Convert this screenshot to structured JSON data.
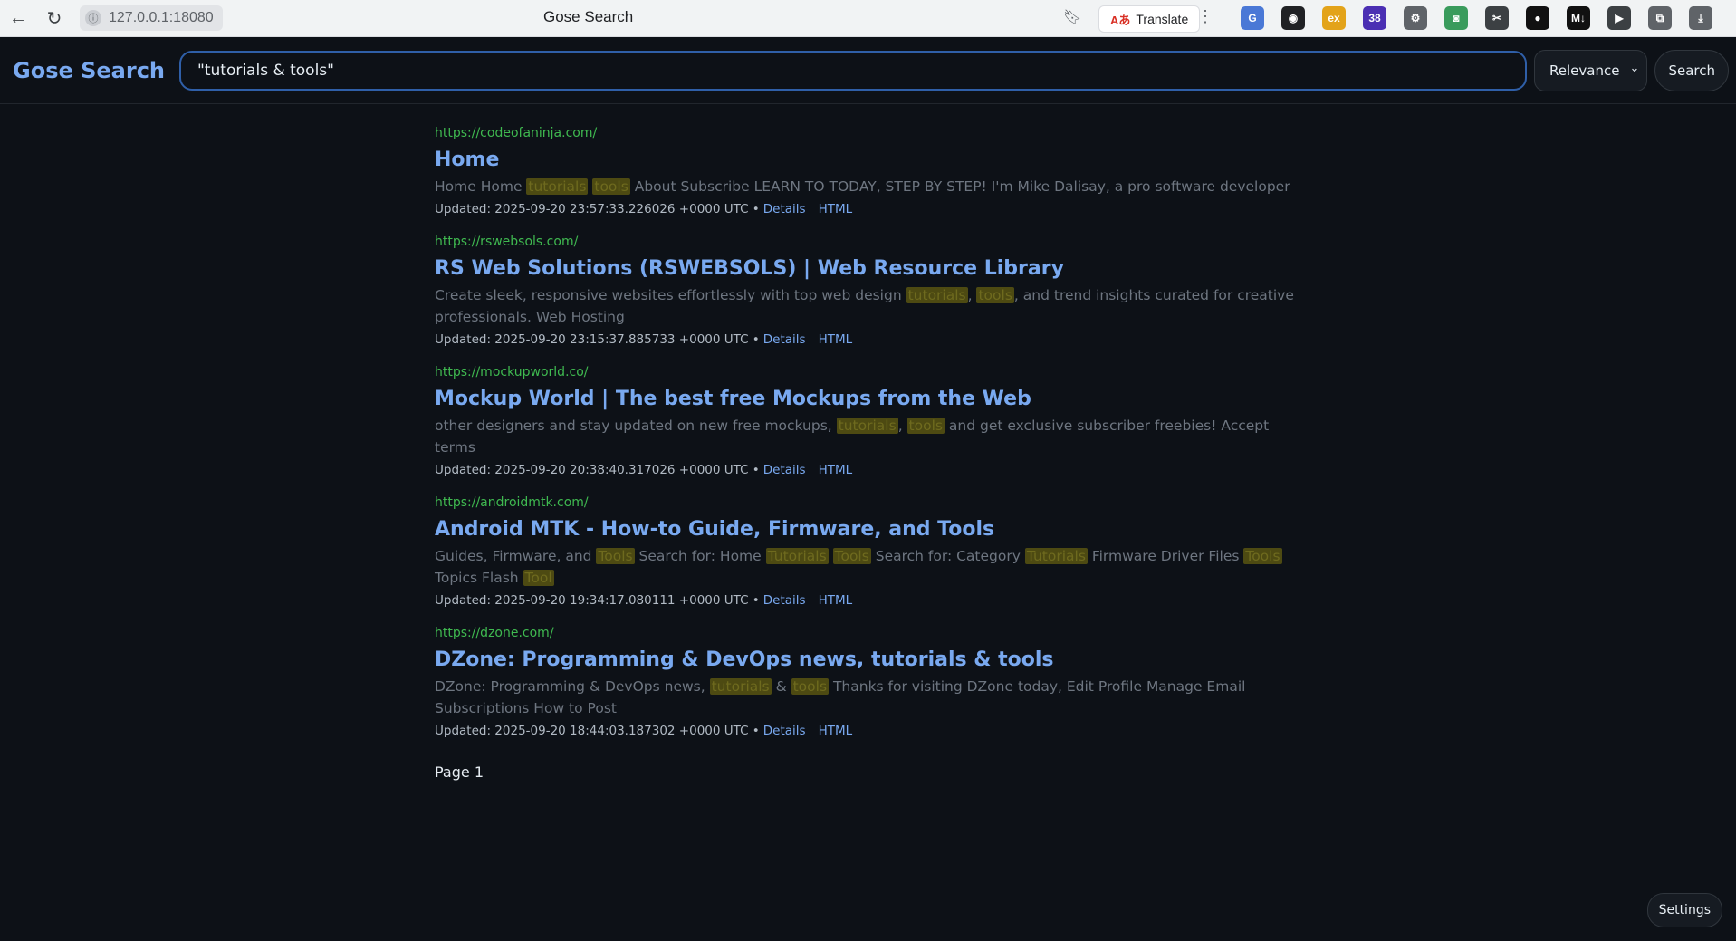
{
  "browser": {
    "url": "127.0.0.1:18080",
    "tab_title": "Gose Search",
    "translate_label": "Translate",
    "extensions": [
      {
        "name": "translate-ext-icon",
        "color": "#4a78d6",
        "glyph": "G"
      },
      {
        "name": "incognito-ext-icon",
        "color": "#202124",
        "glyph": "◉"
      },
      {
        "name": "ex-gen-ext-icon",
        "color": "#e3a31a",
        "glyph": "ex"
      },
      {
        "name": "badge-ext-icon",
        "color": "#4b2fb3",
        "glyph": "38"
      },
      {
        "name": "gear-ext-icon",
        "color": "#5f6368",
        "glyph": "⚙"
      },
      {
        "name": "camera-ext-icon",
        "color": "#3a9b5c",
        "glyph": "◙"
      },
      {
        "name": "scissors-ext-icon",
        "color": "#3c4043",
        "glyph": "✂"
      },
      {
        "name": "circle-ext-icon",
        "color": "#111111",
        "glyph": "●"
      },
      {
        "name": "markdown-ext-icon",
        "color": "#111111",
        "glyph": "M↓"
      },
      {
        "name": "play-ext-icon",
        "color": "#3c4043",
        "glyph": "▶"
      },
      {
        "name": "puzzle-ext-icon",
        "color": "#5f6368",
        "glyph": "⧉"
      },
      {
        "name": "download-icon",
        "color": "#5f6368",
        "glyph": "⤓"
      }
    ]
  },
  "app": {
    "brand": "Gose Search",
    "query": "\"tutorials & tools\"",
    "sort_label": "Relevance",
    "search_label": "Search",
    "settings_label": "Settings",
    "page_label": "Page 1",
    "details_label": "Details",
    "html_label": "HTML"
  },
  "results": [
    {
      "url": "https://codeofaninja.com/",
      "title": "Home",
      "snippet": [
        {
          "t": "Home Home "
        },
        {
          "t": "tutorials",
          "hl": true
        },
        {
          "t": " "
        },
        {
          "t": "tools",
          "hl": true
        },
        {
          "t": " About Subscribe LEARN TO TODAY, STEP BY STEP! I'm Mike Dalisay, a pro software developer"
        }
      ],
      "updated": "Updated: 2025-09-20 23:57:33.226026 +0000 UTC •"
    },
    {
      "url": "https://rswebsols.com/",
      "title": "RS Web Solutions (RSWEBSOLS) | Web Resource Library",
      "snippet": [
        {
          "t": "Create sleek, responsive websites effortlessly with top web design "
        },
        {
          "t": "tutorials",
          "hl": true
        },
        {
          "t": ", "
        },
        {
          "t": "tools",
          "hl": true
        },
        {
          "t": ", and trend insights curated for creative professionals. Web Hosting"
        }
      ],
      "updated": "Updated: 2025-09-20 23:15:37.885733 +0000 UTC •"
    },
    {
      "url": "https://mockupworld.co/",
      "title": "Mockup World | The best free Mockups from the Web",
      "snippet": [
        {
          "t": "other designers and stay updated on new free mockups, "
        },
        {
          "t": "tutorials",
          "hl": true
        },
        {
          "t": ", "
        },
        {
          "t": "tools",
          "hl": true
        },
        {
          "t": " and get exclusive subscriber freebies! Accept terms"
        }
      ],
      "updated": "Updated: 2025-09-20 20:38:40.317026 +0000 UTC •"
    },
    {
      "url": "https://androidmtk.com/",
      "title": "Android MTK - How-to Guide, Firmware, and Tools",
      "snippet": [
        {
          "t": "Guides, Firmware, and "
        },
        {
          "t": "Tools",
          "hl": true
        },
        {
          "t": " Search for: Home "
        },
        {
          "t": "Tutorials",
          "hl": true
        },
        {
          "t": " "
        },
        {
          "t": "Tools",
          "hl": true
        },
        {
          "t": " Search for: Category "
        },
        {
          "t": "Tutorials",
          "hl": true
        },
        {
          "t": " Firmware Driver Files "
        },
        {
          "t": "Tools",
          "hl": true
        },
        {
          "t": " Topics Flash "
        },
        {
          "t": "Tool",
          "hl": true
        }
      ],
      "updated": "Updated: 2025-09-20 19:34:17.080111 +0000 UTC •"
    },
    {
      "url": "https://dzone.com/",
      "title": "DZone: Programming & DevOps news, tutorials & tools",
      "snippet": [
        {
          "t": "DZone: Programming & DevOps news, "
        },
        {
          "t": "tutorials",
          "hl": true
        },
        {
          "t": " & "
        },
        {
          "t": "tools",
          "hl": true
        },
        {
          "t": " Thanks for visiting DZone today, Edit Profile Manage Email Subscriptions How to Post"
        }
      ],
      "updated": "Updated: 2025-09-20 18:44:03.187302 +0000 UTC •"
    }
  ]
}
